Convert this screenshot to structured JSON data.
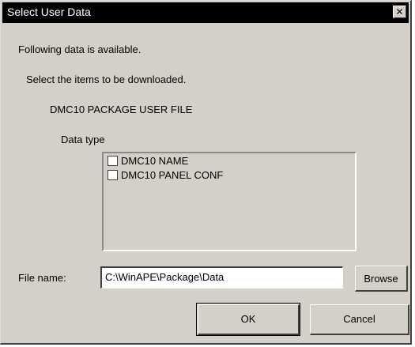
{
  "window": {
    "title": "Select User Data",
    "close_glyph": "✕"
  },
  "messages": {
    "available": "Following data is available.",
    "select": "Select the items to be downloaded.",
    "package": "DMC10 PACKAGE USER FILE"
  },
  "data_type": {
    "label": "Data type",
    "items": [
      {
        "label": "DMC10 NAME",
        "checked": false
      },
      {
        "label": "DMC10 PANEL CONF",
        "checked": false
      }
    ]
  },
  "file": {
    "label": "File name:",
    "value": "C:\\WinAPE\\Package\\Data",
    "browse_label": "Browse"
  },
  "buttons": {
    "ok_label": "OK",
    "cancel_label": "Cancel"
  }
}
